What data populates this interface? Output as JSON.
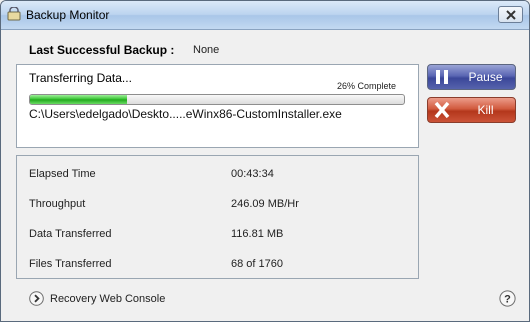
{
  "window": {
    "title": "Backup Monitor"
  },
  "summary": {
    "label": "Last Successful Backup :",
    "value": "None"
  },
  "transfer": {
    "status": "Transferring Data...",
    "percent_text": "26% Complete",
    "progress": 0.26,
    "file": "C:\\Users\\edelgado\\Deskto.....eWinx86-CustomInstaller.exe"
  },
  "buttons": {
    "pause": "Pause",
    "kill": "Kill"
  },
  "stats": [
    {
      "label": "Elapsed Time",
      "value": "00:43:34"
    },
    {
      "label": "Throughput",
      "value": "246.09 MB/Hr"
    },
    {
      "label": "Data Transferred",
      "value": "116.81 MB"
    },
    {
      "label": "Files Transferred",
      "value": "68 of 1760"
    }
  ],
  "footer": {
    "link": "Recovery Web Console"
  },
  "icons": [
    "app-icon",
    "close-icon",
    "pause-icon",
    "kill-icon",
    "arrow-right-icon",
    "help-icon"
  ],
  "colors": {
    "progress": "#31c02c",
    "pause": "#3b4799",
    "kill": "#b4371c"
  }
}
